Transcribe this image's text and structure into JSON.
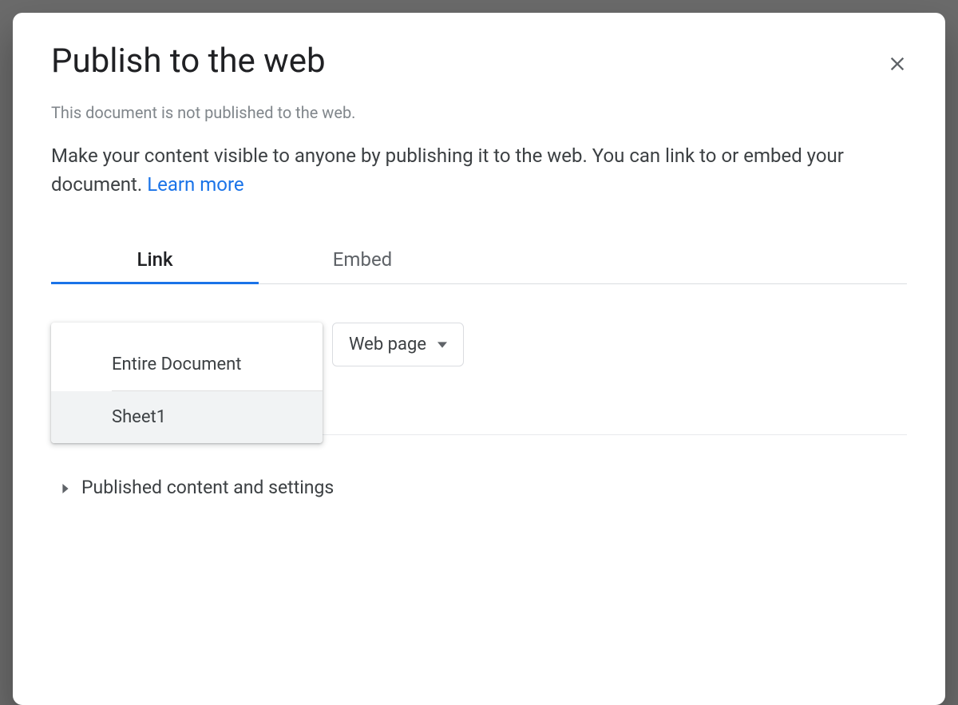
{
  "dialog": {
    "title": "Publish to the web",
    "status": "This document is not published to the web.",
    "description": "Make your content visible to anyone by publishing it to the web. You can link to or embed your document. ",
    "learn_more": "Learn more"
  },
  "tabs": {
    "link": "Link",
    "embed": "Embed"
  },
  "selects": {
    "scope_options": [
      "Entire Document",
      "Sheet1"
    ],
    "format_selected": "Web page"
  },
  "expander": {
    "label": "Published content and settings"
  }
}
